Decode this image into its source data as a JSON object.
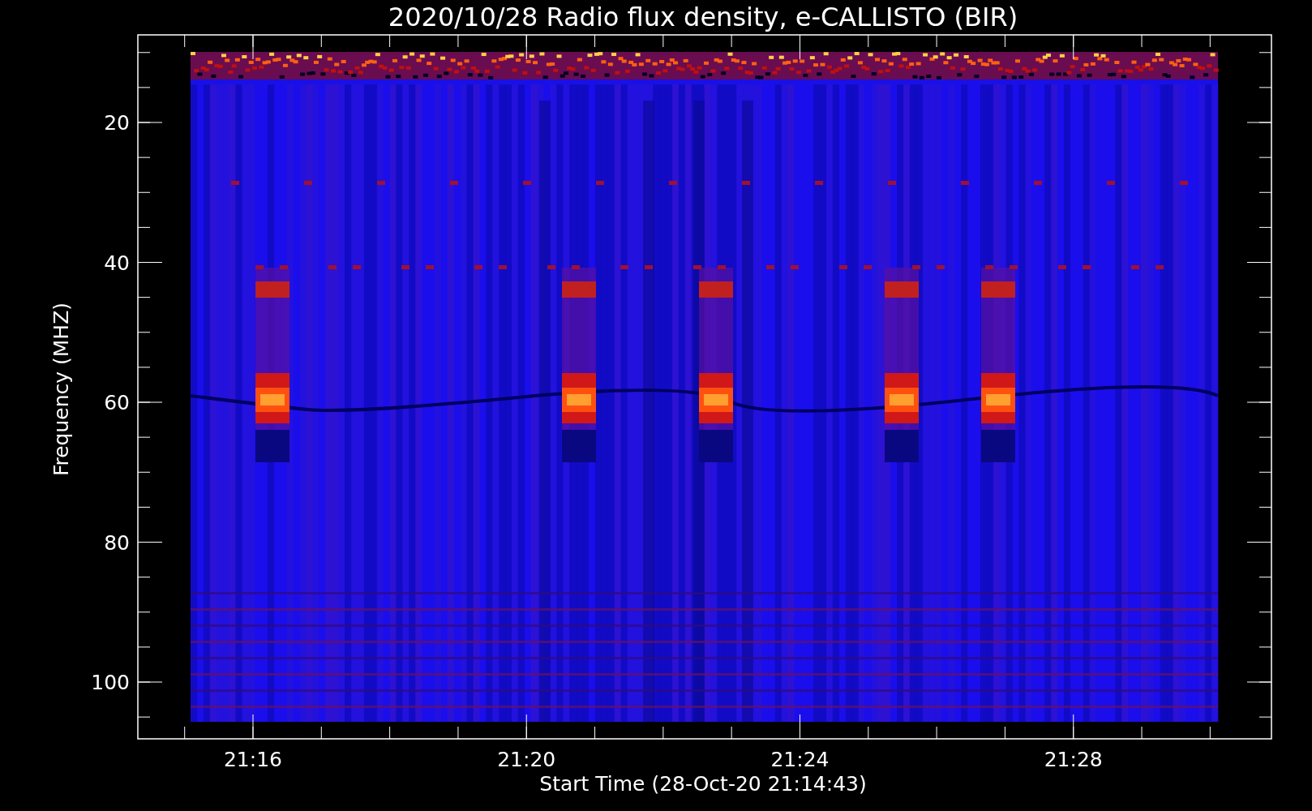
{
  "plot": {
    "title": "2020/10/28  Radio flux density, e-CALLISTO (BIR)",
    "ylabel": "Frequency (MHZ)",
    "xlabel": "Start Time (28-Oct-20 21:14:43)",
    "yticks": [
      "20",
      "40",
      "60",
      "80",
      "100"
    ],
    "xticks": [
      "21:16",
      "21:20",
      "21:24",
      "21:28"
    ]
  }
}
